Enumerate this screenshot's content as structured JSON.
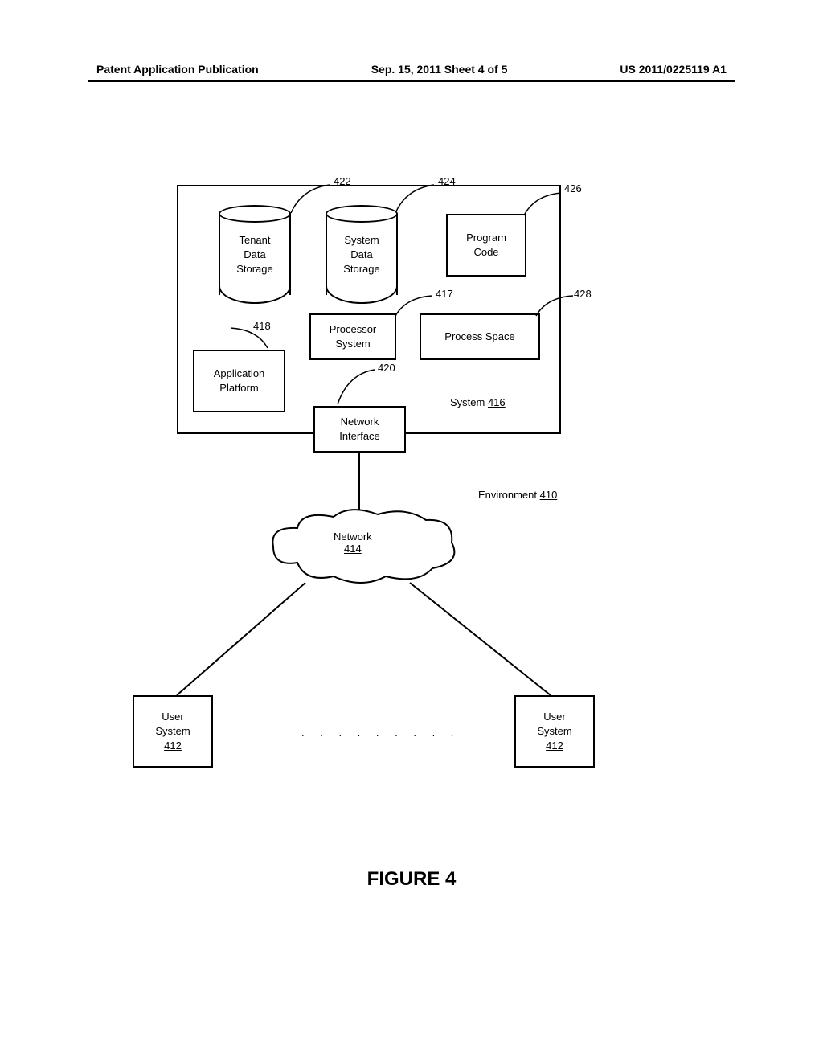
{
  "header": {
    "left": "Patent Application Publication",
    "center": "Sep. 15, 2011  Sheet 4 of 5",
    "right": "US 2011/0225119 A1"
  },
  "diagram": {
    "tenant_storage": {
      "line1": "Tenant",
      "line2": "Data",
      "line3": "Storage",
      "ref": "422"
    },
    "system_storage": {
      "line1": "System",
      "line2": "Data",
      "line3": "Storage",
      "ref": "424"
    },
    "program_code": {
      "line1": "Program",
      "line2": "Code",
      "ref": "426"
    },
    "processor_system": {
      "line1": "Processor",
      "line2": "System",
      "ref": "417"
    },
    "process_space": {
      "text": "Process Space",
      "ref": "428"
    },
    "application_platform": {
      "line1": "Application",
      "line2": "Platform",
      "ref": "418"
    },
    "network_interface": {
      "line1": "Network",
      "line2": "Interface",
      "ref": "420"
    },
    "system_label": {
      "text": "System",
      "ref": "416"
    },
    "network": {
      "text": "Network",
      "ref": "414"
    },
    "environment": {
      "text": "Environment",
      "ref": "410"
    },
    "user_system_left": {
      "line1": "User",
      "line2": "System",
      "ref": "412"
    },
    "user_system_right": {
      "line1": "User",
      "line2": "System",
      "ref": "412"
    },
    "ellipsis": ". . . . . . . . ."
  },
  "figure_title": "FIGURE 4"
}
